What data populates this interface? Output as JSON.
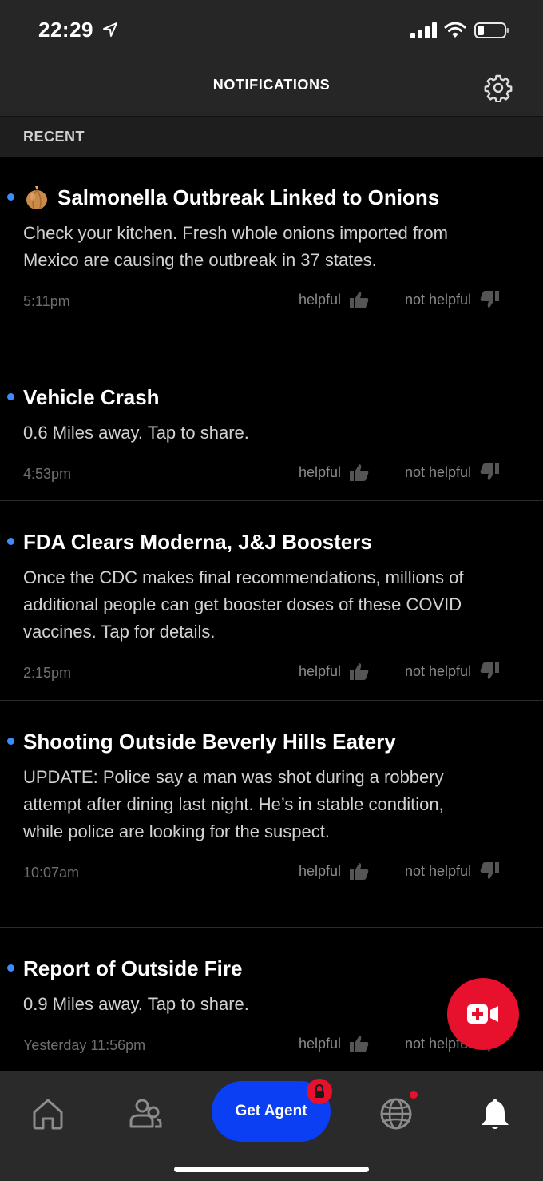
{
  "status_bar": {
    "time": "22:29",
    "icons": [
      "location-arrow-icon",
      "cellular-signal-icon",
      "wifi-icon",
      "battery-icon"
    ]
  },
  "header": {
    "title": "NOTIFICATIONS",
    "settings_icon": "gear-icon"
  },
  "section": {
    "title": "RECENT"
  },
  "feedback": {
    "helpful": "helpful",
    "not_helpful": "not helpful"
  },
  "notifications": [
    {
      "icon": "onion-emoji",
      "title": "Salmonella Outbreak Linked to Onions",
      "body": "Check your kitchen. Fresh whole onions imported from Mexico are causing the outbreak in 37 states.",
      "time": "5:11pm"
    },
    {
      "title": "Vehicle Crash",
      "body": "0.6 Miles away. Tap to share.",
      "time": "4:53pm"
    },
    {
      "title": "FDA Clears Moderna, J&J Boosters",
      "body": "Once the CDC makes final recommendations, millions of additional people can get booster doses of these COVID vaccines. Tap for details.",
      "time": "2:15pm"
    },
    {
      "title": "Shooting Outside Beverly Hills Eatery",
      "body": "UPDATE: Police say a man was shot during a robbery attempt after dining last night. He’s in stable condition, while police are looking for the suspect.",
      "time": "10:07am"
    },
    {
      "title": "Report of Outside Fire",
      "body": "0.9 Miles away. Tap to share.",
      "time": "Yesterday 11:56pm"
    }
  ],
  "fab": {
    "icon": "video-plus-icon"
  },
  "tab_bar": {
    "tabs": [
      "home-icon",
      "people-icon",
      "get-agent",
      "globe-icon",
      "bell-icon"
    ],
    "get_agent_label": "Get Agent",
    "active_tab": "bell-icon",
    "colors": {
      "agent_button": "#0a3ff3",
      "badge": "#e8112d"
    }
  }
}
